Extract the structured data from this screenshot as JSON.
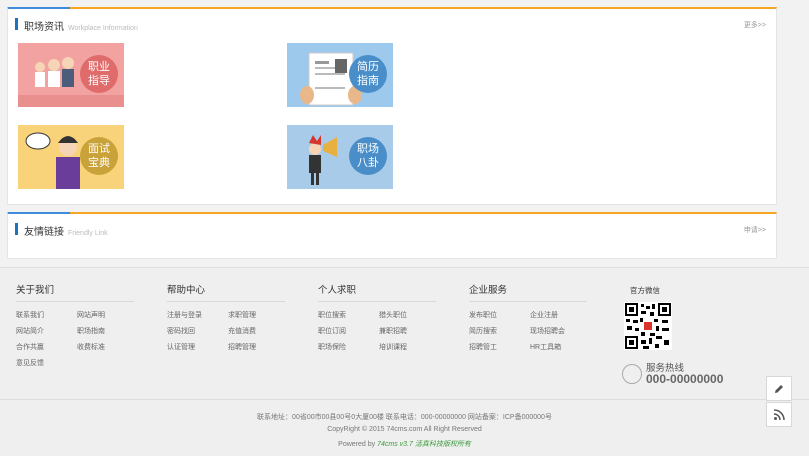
{
  "news": {
    "title": "职场资讯",
    "subtitle": "Workplace Information",
    "more": "更多>>",
    "tiles": [
      {
        "label_line1": "职业",
        "label_line2": "指导"
      },
      {
        "label_line1": "简历",
        "label_line2": "指南"
      },
      {
        "label_line1": "面试",
        "label_line2": "宝典"
      },
      {
        "label_line1": "职场",
        "label_line2": "八卦"
      }
    ]
  },
  "friend_links": {
    "title": "友情链接",
    "subtitle": "Friendly Link",
    "apply": "申请>>"
  },
  "footer": {
    "columns": [
      {
        "title": "关于我们",
        "links": [
          "联系我们",
          "网站声明",
          "网站简介",
          "职场指南",
          "合作共赢",
          "收费标准",
          "意见反馈"
        ]
      },
      {
        "title": "帮助中心",
        "links": [
          "注册与登录",
          "求职管理",
          "密码找回",
          "充值消费",
          "认证管理",
          "招聘管理"
        ]
      },
      {
        "title": "个人求职",
        "links": [
          "职位搜索",
          "猎头职位",
          "职位订阅",
          "兼职招聘",
          "职场保险",
          "培训课程"
        ]
      },
      {
        "title": "企业服务",
        "links": [
          "发布职位",
          "企业注册",
          "简历搜索",
          "现场招聘会",
          "招聘管工",
          "HR工具箱"
        ]
      }
    ],
    "wechat_label": "官方微信",
    "hotline_label": "服务热线",
    "hotline_number": "000-00000000",
    "address_line": "联系地址：00省00市00县00号0大厦00楼 联系电话：000-00000000 网站备案：ICP备000000号",
    "copyright_line": "CopyRight © 2015 74cms.com All Right Reserved",
    "powered_prefix": "Powered by ",
    "powered_brand": "74cms v3.7 活真科技版权所有"
  },
  "side_tools": {
    "edit_icon": "pencil-icon",
    "rss_icon": "rss-icon"
  }
}
